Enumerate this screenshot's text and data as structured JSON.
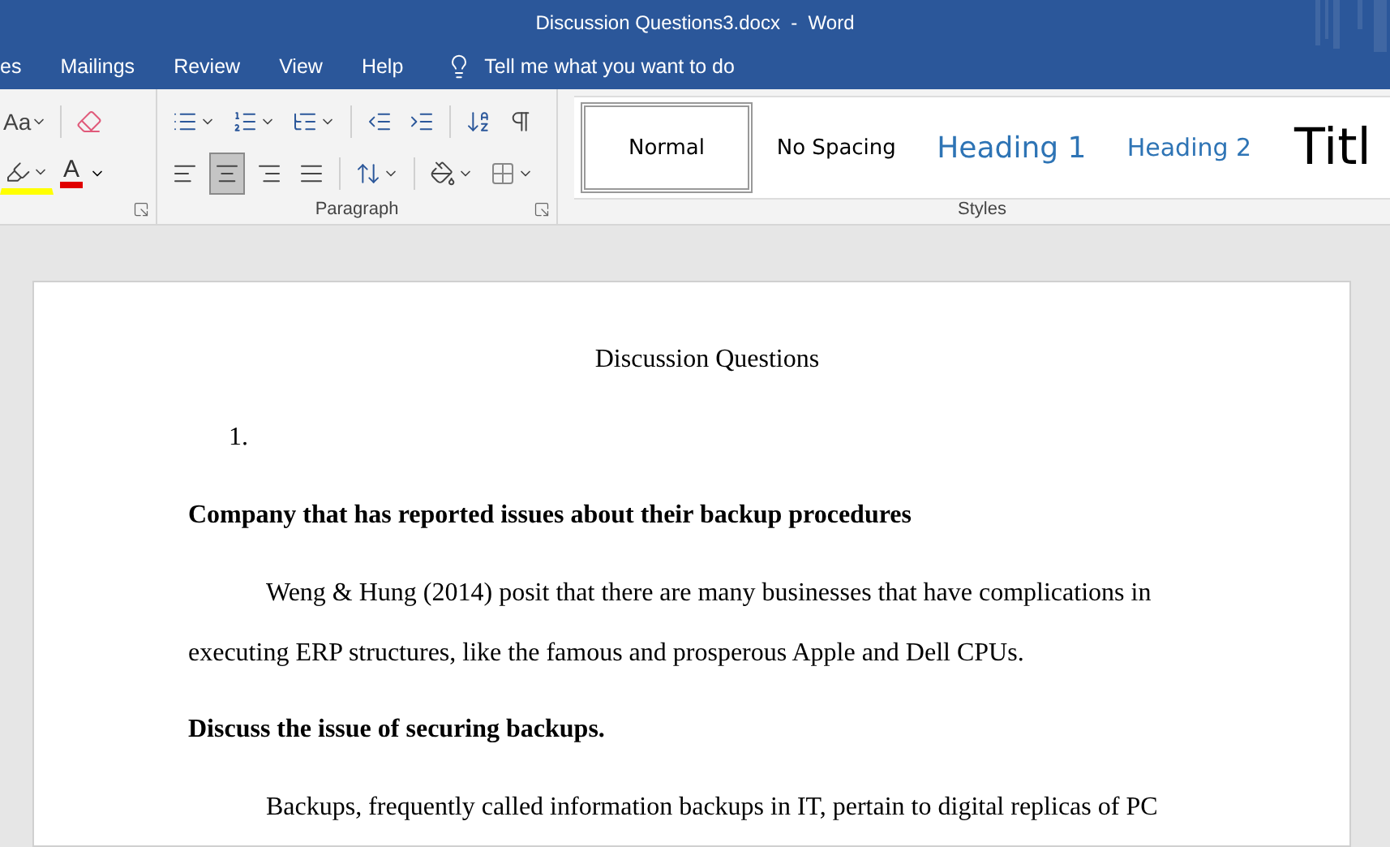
{
  "window": {
    "title": "Discussion Questions3.docx  -  Word"
  },
  "tabs": [
    {
      "label": "es",
      "selected": false
    },
    {
      "label": "Mailings",
      "selected": false
    },
    {
      "label": "Review",
      "selected": false
    },
    {
      "label": "View",
      "selected": false
    },
    {
      "label": "Help",
      "selected": false
    }
  ],
  "tell_me": {
    "placeholder": "Tell me what you want to do"
  },
  "font_group": {
    "case_label": "Aa",
    "font_color_label": "A"
  },
  "paragraph_group": {
    "label": "Paragraph",
    "alignments": [
      {
        "kind": "left",
        "selected": false
      },
      {
        "kind": "center",
        "selected": true
      },
      {
        "kind": "right",
        "selected": false
      },
      {
        "kind": "justify",
        "selected": false
      }
    ]
  },
  "styles_group": {
    "label": "Styles",
    "styles": [
      {
        "name": "Normal",
        "kind": "normal",
        "selected": true
      },
      {
        "name": "No Spacing",
        "kind": "nospacing",
        "selected": false
      },
      {
        "name": "Heading 1",
        "kind": "heading1",
        "selected": false
      },
      {
        "name": "Heading 2",
        "kind": "heading2",
        "selected": false
      },
      {
        "name": "Titl",
        "kind": "title",
        "selected": false
      }
    ]
  },
  "document": {
    "paragraphs": [
      {
        "kind": "title",
        "text": "Discussion Questions"
      },
      {
        "kind": "number",
        "text": "1."
      },
      {
        "kind": "heading",
        "text": "Company that has reported issues about their backup procedures"
      },
      {
        "kind": "body",
        "text": "Weng & Hung (2014) posit that there are many businesses that have complications in executing ERP structures, like the famous and prosperous Apple and Dell CPUs."
      },
      {
        "kind": "heading",
        "text": "Discuss the issue of securing backups."
      },
      {
        "kind": "body",
        "text": "Backups, frequently called information backups in IT, pertain to digital replicas of PC"
      }
    ]
  }
}
